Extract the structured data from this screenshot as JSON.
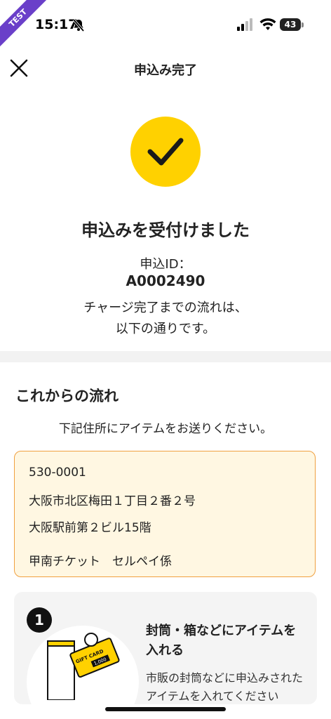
{
  "status": {
    "time": "15:17",
    "battery": "43",
    "ribbon": "TEST"
  },
  "header": {
    "title": "申込み完了"
  },
  "result": {
    "headline": "申込みを受付けました",
    "id_label": "申込ID：",
    "id_value": "A0002490",
    "desc_line1": "チャージ完了までの流れは、",
    "desc_line2": "以下の通りです。"
  },
  "flow": {
    "title": "これからの流れ",
    "instruction": "下記住所にアイテムをお送りください。",
    "address": {
      "postal": "530-0001",
      "line1": "大阪市北区梅田１丁目２番２号",
      "line2": "大阪駅前第２ビル15階",
      "recipient": "甲南チケット　セルペイ係"
    },
    "steps": [
      {
        "number": "1",
        "title": "封筒・箱などにアイテムを入れる",
        "body": "市販の封筒などに申込みされたアイテムを入れてください"
      }
    ],
    "card_text": "GIFT CARD",
    "card_amount": "1,000"
  },
  "colors": {
    "accent": "#ffd100",
    "address_bg": "#fff7e2",
    "address_border": "#f0a040",
    "ribbon": "#6a3fc9"
  },
  "icons": {
    "close": "close-icon",
    "check": "check-icon",
    "bell": "bell-slash-icon",
    "signal": "cellular-signal-icon",
    "wifi": "wifi-icon"
  }
}
